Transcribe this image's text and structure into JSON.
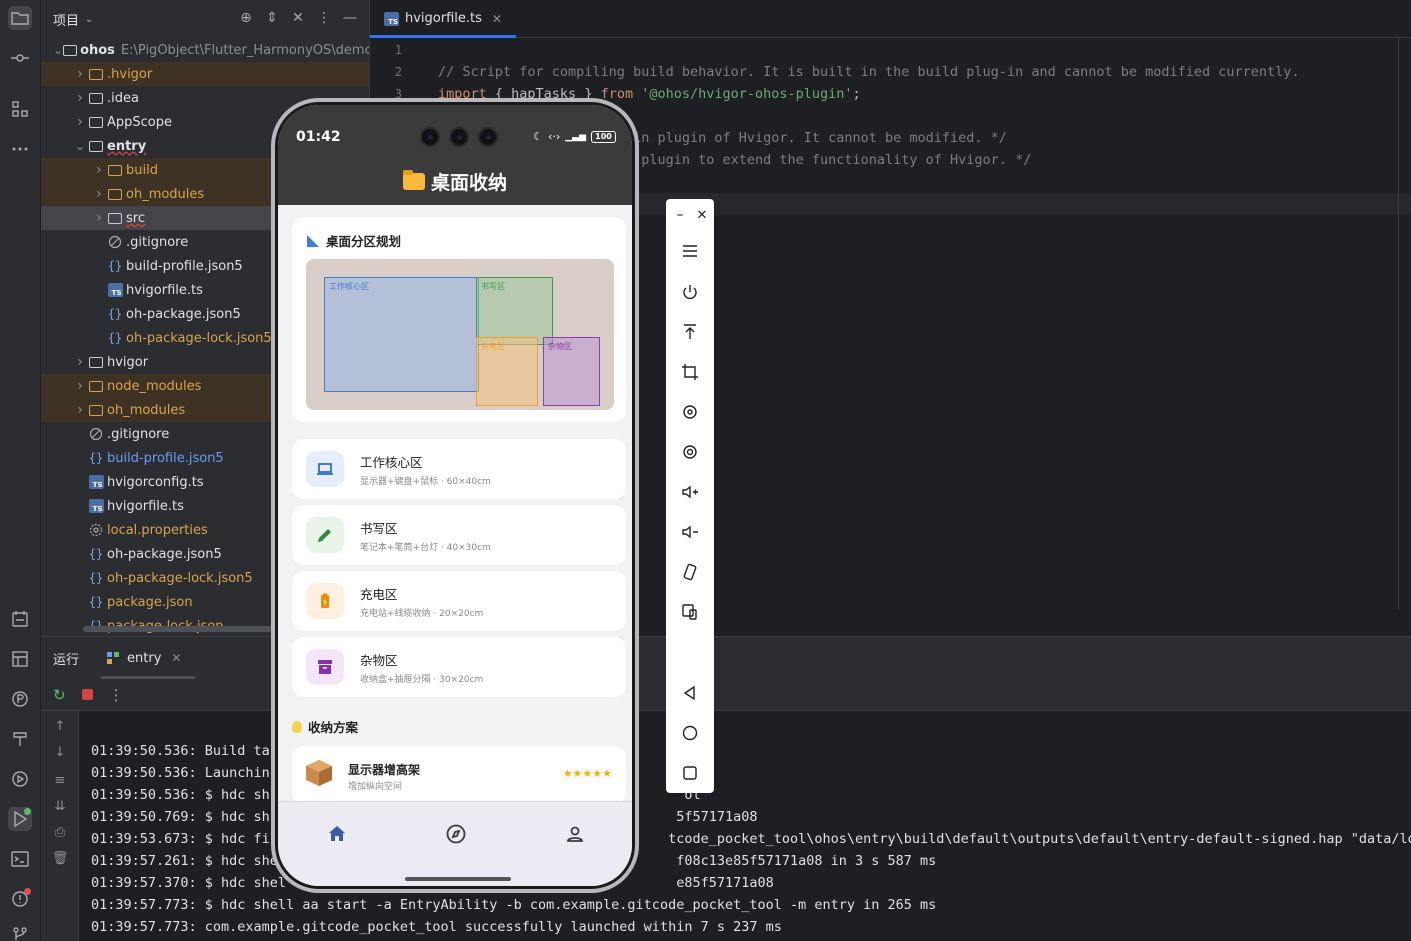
{
  "project": {
    "title": "项目",
    "tree": [
      {
        "label": "ohos",
        "path": "E:\\PigObject\\Flutter_HarmonyOS\\demo\\g",
        "depth": 0,
        "kind": "module",
        "style": "normal",
        "open": true
      },
      {
        "label": ".hvigor",
        "depth": 1,
        "kind": "folder",
        "style": "excluded"
      },
      {
        "label": ".idea",
        "depth": 1,
        "kind": "folder",
        "style": "normal"
      },
      {
        "label": "AppScope",
        "depth": 1,
        "kind": "folder",
        "style": "normal"
      },
      {
        "label": "entry",
        "depth": 1,
        "kind": "module",
        "style": "normal",
        "open": true
      },
      {
        "label": "build",
        "depth": 2,
        "kind": "folder",
        "style": "excluded"
      },
      {
        "label": "oh_modules",
        "depth": 2,
        "kind": "folder",
        "style": "excluded"
      },
      {
        "label": "src",
        "depth": 2,
        "kind": "folder",
        "style": "selected"
      },
      {
        "label": ".gitignore",
        "depth": 2,
        "kind": "ignore",
        "style": "normal",
        "leaf": true
      },
      {
        "label": "build-profile.json5",
        "depth": 2,
        "kind": "json",
        "style": "normal",
        "leaf": true
      },
      {
        "label": "hvigorfile.ts",
        "depth": 2,
        "kind": "ts",
        "style": "normal",
        "leaf": true
      },
      {
        "label": "oh-package.json5",
        "depth": 2,
        "kind": "json",
        "style": "normal",
        "leaf": true
      },
      {
        "label": "oh-package-lock.json5",
        "depth": 2,
        "kind": "json",
        "style": "excluded-text",
        "leaf": true
      },
      {
        "label": "hvigor",
        "depth": 1,
        "kind": "folder",
        "style": "normal"
      },
      {
        "label": "node_modules",
        "depth": 1,
        "kind": "folder",
        "style": "excluded"
      },
      {
        "label": "oh_modules",
        "depth": 1,
        "kind": "folder",
        "style": "excluded"
      },
      {
        "label": ".gitignore",
        "depth": 1,
        "kind": "ignore",
        "style": "normal",
        "leaf": true
      },
      {
        "label": "build-profile.json5",
        "depth": 1,
        "kind": "json",
        "style": "blue",
        "leaf": true
      },
      {
        "label": "hvigorconfig.ts",
        "depth": 1,
        "kind": "ts",
        "style": "normal",
        "leaf": true
      },
      {
        "label": "hvigorfile.ts",
        "depth": 1,
        "kind": "ts",
        "style": "normal",
        "leaf": true
      },
      {
        "label": "local.properties",
        "depth": 1,
        "kind": "gear",
        "style": "excluded-text",
        "leaf": true
      },
      {
        "label": "oh-package.json5",
        "depth": 1,
        "kind": "json",
        "style": "normal",
        "leaf": true
      },
      {
        "label": "oh-package-lock.json5",
        "depth": 1,
        "kind": "json",
        "style": "excluded-text",
        "leaf": true
      },
      {
        "label": "package.json",
        "depth": 1,
        "kind": "json",
        "style": "excluded-text",
        "leaf": true
      },
      {
        "label": "package-lock.json",
        "depth": 1,
        "kind": "json",
        "style": "excluded-text",
        "leaf": true
      }
    ]
  },
  "editor": {
    "tab": "hvigorfile.ts",
    "lines": [
      {
        "num": "1",
        "parts": []
      },
      {
        "num": "2",
        "parts": [
          {
            "cls": "c-comment",
            "text": "// Script for compiling build behavior. It is built in the build plug-in and cannot be modified currently."
          }
        ]
      },
      {
        "num": "3",
        "parts": [
          {
            "cls": "c-kw",
            "text": "import"
          },
          {
            "cls": "c-id",
            "text": " { hapTasks } "
          },
          {
            "cls": "c-kw",
            "text": "from"
          },
          {
            "cls": "c-str",
            "text": " '@ohos/hvigor-ohos-plugin'"
          },
          {
            "cls": "c-id",
            "text": ";"
          }
        ]
      },
      {
        "num": "",
        "parts": []
      },
      {
        "num": "",
        "parts": [
          {
            "cls": "c-comment",
            "text": "                  Built-in plugin of Hvigor. It cannot be modified. */"
          }
        ]
      },
      {
        "num": "",
        "parts": [
          {
            "cls": "c-comment",
            "text": "                  Custom plugin to extend the functionality of Hvigor. */"
          }
        ]
      }
    ]
  },
  "run": {
    "title": "运行",
    "tab": "entry",
    "logs": [
      "01:39:50.536: Build ta",
      "01:39:50.536: Launchin",
      "01:39:50.536: $ hdc sh                                                   ol",
      "01:39:50.769: $ hdc sh                                                  5f57171a08",
      "01:39:53.673: $ hdc fi                                                 tcode_pocket_tool\\ohos\\entry\\build\\default\\outputs\\default\\entry-default-signed.hap \"data/local/t",
      "01:39:57.261: $ hdc she                                                 f08c13e85f57171a08 in 3 s 587 ms",
      "01:39:57.370: $ hdc shel                                                e85f57171a08",
      "01:39:57.773: $ hdc shell aa start -a EntryAbility -b com.example.gitcode_pocket_tool -m entry in 265 ms",
      "01:39:57.773: com.example.gitcode_pocket_tool successfully launched within 7 s 237 ms"
    ]
  },
  "phone": {
    "time": "01:42",
    "battery": "100",
    "app_title": "桌面收纳",
    "plan_title": "桌面分区规划",
    "zones_map": [
      {
        "label": "工作核心区",
        "color": "#3f7fd6"
      },
      {
        "label": "书写区",
        "color": "#3f9a4a"
      },
      {
        "label": "充电区",
        "color": "#f0a030"
      },
      {
        "label": "杂物区",
        "color": "#8a3fb0"
      }
    ],
    "zones": [
      {
        "name": "工作核心区",
        "desc": "显示器+键盘+鼠标 · 60×40cm",
        "icon": "laptop-icon",
        "color": "#2f6fd0",
        "bg": "#e6eefb"
      },
      {
        "name": "书写区",
        "desc": "笔记本+笔筒+台灯 · 40×30cm",
        "icon": "pencil-icon",
        "color": "#2e8a3c",
        "bg": "#e8f4ea"
      },
      {
        "name": "充电区",
        "desc": "充电站+线缆收纳 · 20×20cm",
        "icon": "battery-charging-icon",
        "color": "#f08a00",
        "bg": "#fdf0e0"
      },
      {
        "name": "杂物区",
        "desc": "收纳盒+抽屉分隔 · 30×20cm",
        "icon": "archive-icon",
        "color": "#8a2fb0",
        "bg": "#f3e6f8"
      }
    ],
    "solutions_title": "收纳方案",
    "solution": {
      "name": "显示器增高架",
      "desc": "增加纵向空间",
      "stars": "★★★★★"
    }
  }
}
